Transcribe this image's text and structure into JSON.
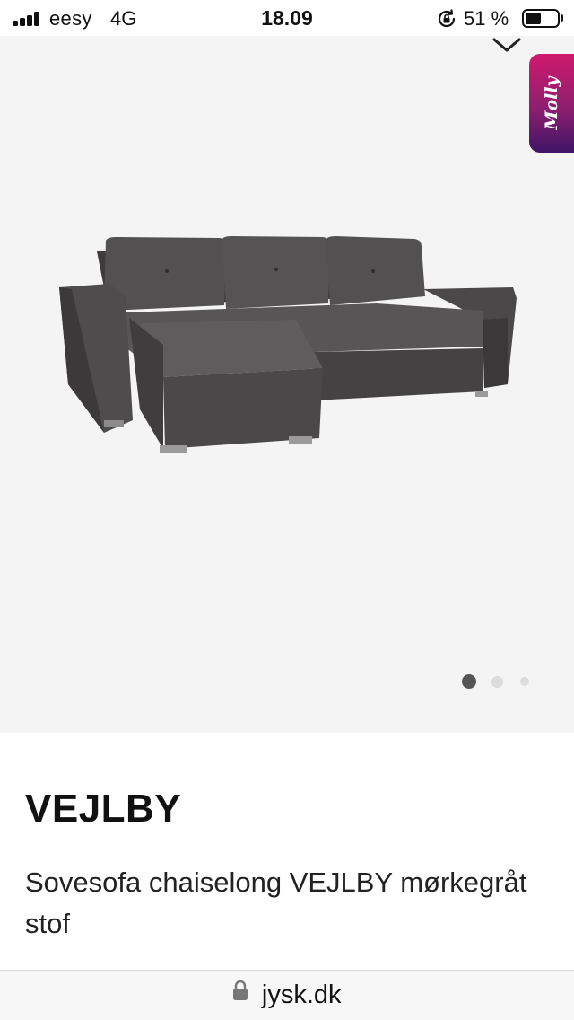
{
  "status_bar": {
    "carrier": "eesy",
    "network": "4G",
    "time": "18.09",
    "battery_percent": "51 %",
    "battery_level": 0.51,
    "signal_bars": 4
  },
  "gallery": {
    "chat_widget_label": "Molly",
    "image_alt": "Sovesofa chaiselong VEJLBY mørkegråt stof",
    "carousel": {
      "count": 3,
      "active_index": 0
    }
  },
  "product": {
    "name": "VEJLBY",
    "description": "Sovesofa chaiselong VEJLBY mørkegråt stof"
  },
  "browser": {
    "url": "jysk.dk"
  },
  "colors": {
    "gallery_background": "#f4f4f4",
    "sofa_fabric": "#4a4848",
    "molly_gradient_top": "#d0196d",
    "molly_gradient_bottom": "#3f1466",
    "dot_active": "#555555",
    "dot_inactive": "#dcdcdc"
  }
}
